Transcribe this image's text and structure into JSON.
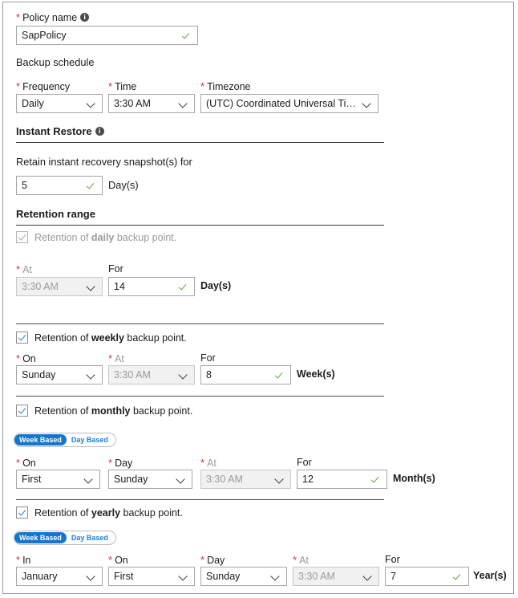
{
  "policy": {
    "label": "Policy name",
    "required": true,
    "info_icon": "info-icon",
    "value": "SapPolicy",
    "placeholder": "Policy name",
    "valid_icon": "check-icon"
  },
  "backup_schedule": {
    "title": "Backup schedule",
    "frequency": {
      "label": "Frequency",
      "value": "Daily",
      "required": true
    },
    "time": {
      "label": "Time",
      "value": "3:30 AM",
      "required": true
    },
    "timezone": {
      "label": "Timezone",
      "value": "(UTC) Coordinated Universal Time",
      "required": true
    }
  },
  "instant_restore": {
    "title": "Instant Restore",
    "info_icon": "info-icon",
    "retain_label": "Retain instant recovery snapshot(s) for",
    "value": "5",
    "unit": "Day(s)"
  },
  "retention_range": {
    "title": "Retention range",
    "daily": {
      "checkbox_label_prefix": "Retention of ",
      "checkbox_label_strong": "daily",
      "checkbox_label_suffix": " backup point.",
      "checked": true,
      "enabled": false,
      "at": {
        "label": "At",
        "value": "3:30 AM",
        "required": true,
        "enabled": false
      },
      "for": {
        "label": "For",
        "value": "14",
        "unit": "Day(s)"
      }
    },
    "weekly": {
      "checkbox_label_prefix": "Retention of ",
      "checkbox_label_strong": "weekly",
      "checkbox_label_suffix": " backup point.",
      "checked": true,
      "enabled": true,
      "on": {
        "label": "On",
        "value": "Sunday",
        "required": true
      },
      "at": {
        "label": "At",
        "value": "3:30 AM",
        "required": true,
        "enabled": false
      },
      "for": {
        "label": "For",
        "value": "8",
        "unit": "Week(s)"
      }
    },
    "monthly": {
      "checkbox_label_prefix": "Retention of ",
      "checkbox_label_strong": "monthly",
      "checkbox_label_suffix": " backup point.",
      "checked": true,
      "enabled": true,
      "toggle": {
        "option_week": "Week Based",
        "option_day": "Day Based",
        "selected": "Week Based"
      },
      "on": {
        "label": "On",
        "value": "First",
        "required": true
      },
      "day": {
        "label": "Day",
        "value": "Sunday",
        "required": true
      },
      "at": {
        "label": "At",
        "value": "3:30 AM",
        "required": true,
        "enabled": false
      },
      "for": {
        "label": "For",
        "value": "12",
        "unit": "Month(s)"
      }
    },
    "yearly": {
      "checkbox_label_prefix": "Retention of ",
      "checkbox_label_strong": "yearly",
      "checkbox_label_suffix": " backup point.",
      "checked": true,
      "enabled": true,
      "toggle": {
        "option_week": "Week Based",
        "option_day": "Day Based",
        "selected": "Week Based"
      },
      "in": {
        "label": "In",
        "value": "January",
        "required": true
      },
      "on": {
        "label": "On",
        "value": "First",
        "required": true
      },
      "day": {
        "label": "Day",
        "value": "Sunday",
        "required": true
      },
      "at": {
        "label": "At",
        "value": "3:30 AM",
        "required": true,
        "enabled": false
      },
      "for": {
        "label": "For",
        "value": "7",
        "unit": "Year(s)"
      }
    }
  },
  "colors": {
    "required_asterisk": "#d63333",
    "valid_check": "#5aa52b",
    "checkbox_check": "#1c7fd6",
    "toggle_active_bg": "#1177d1",
    "border": "#a6a6a6",
    "disabled_bg": "#f1f1f1"
  }
}
